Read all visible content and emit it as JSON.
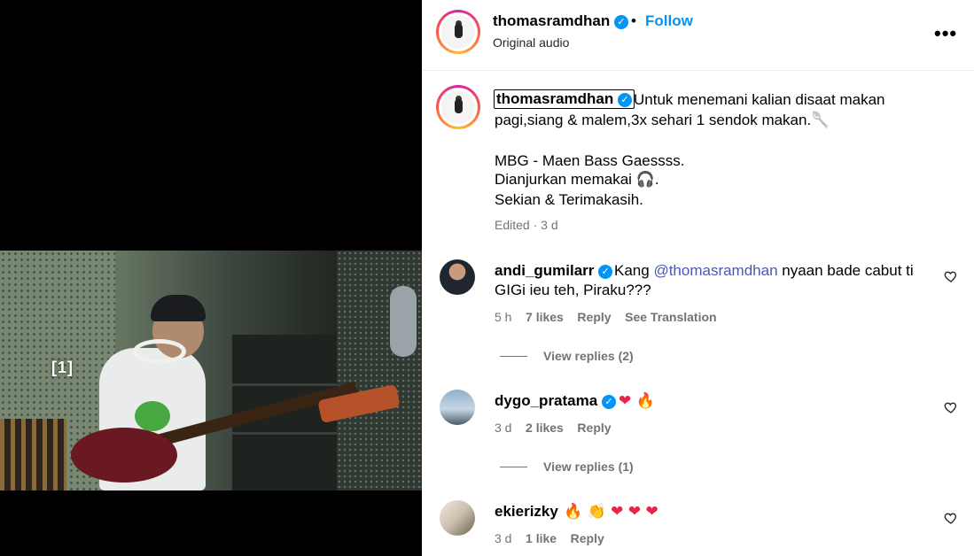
{
  "media": {
    "overlay_label": "[1]"
  },
  "header": {
    "username": "thomasramdhan",
    "separator": "•",
    "follow_label": "Follow",
    "subtitle": "Original audio",
    "more_label": "•••"
  },
  "caption": {
    "username": "thomasramdhan",
    "line1": "Untuk menemani kalian disaat makan",
    "line2": "pagi,siang & malem,3x sehari 1 sendok makan.🥄",
    "line3": "MBG - Maen Bass Gaessss.",
    "line4_prefix": "Dianjurkan memakai ",
    "line4_emoji": "🎧",
    "line4_suffix": ".",
    "line5": "Sekian & Terimakasih.",
    "meta": "Edited · 3 d"
  },
  "comments": [
    {
      "username": "andi_gumilarr",
      "text_prefix": "Kang ",
      "mention": "@thomasramdhan",
      "text_suffix": " nyaan bade cabut ti",
      "text_line2": "GIGi ieu teh, Piraku???",
      "time": "5 h",
      "likes": "7 likes",
      "reply_label": "Reply",
      "translate_label": "See Translation",
      "view_replies": "View replies (2)"
    },
    {
      "username": "dygo_pratama",
      "emojis": [
        "❤",
        "🔥"
      ],
      "time": "3 d",
      "likes": "2 likes",
      "reply_label": "Reply",
      "view_replies": "View replies (1)"
    },
    {
      "username": "ekierizky",
      "emojis": [
        "🔥",
        "👏",
        "❤",
        "❤",
        "❤"
      ],
      "time": "3 d",
      "likes": "1 like",
      "reply_label": "Reply"
    }
  ],
  "colors": {
    "link_blue": "#0095f6",
    "mention": "#4a57b6",
    "muted": "#737373",
    "verified": "#0095f6"
  },
  "icons": {
    "more": "more-horizontal-icon",
    "verified": "verified-badge-icon",
    "like": "heart-outline-icon"
  }
}
